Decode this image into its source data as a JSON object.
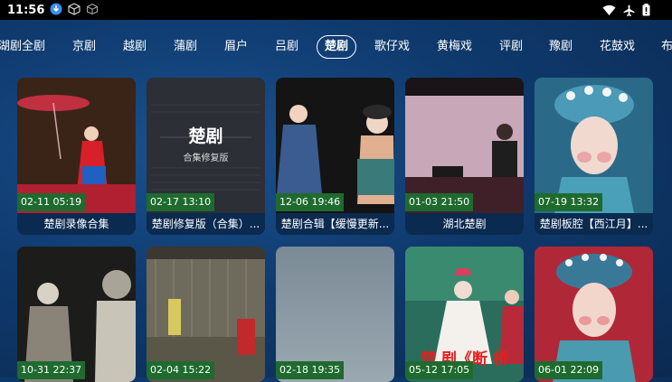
{
  "status": {
    "time": "11:56"
  },
  "tabs": [
    {
      "label": "湖剧全剧"
    },
    {
      "label": "京剧"
    },
    {
      "label": "越剧"
    },
    {
      "label": "蒲剧"
    },
    {
      "label": "眉户"
    },
    {
      "label": "吕剧"
    },
    {
      "label": "楚剧",
      "active": true
    },
    {
      "label": "歌仔戏"
    },
    {
      "label": "黄梅戏"
    },
    {
      "label": "评剧"
    },
    {
      "label": "豫剧"
    },
    {
      "label": "花鼓戏"
    },
    {
      "label": "布"
    }
  ],
  "cards_row1": [
    {
      "date": "02-11 05:19",
      "title": "楚剧录像合集"
    },
    {
      "date": "02-17 13:10",
      "title": "楚剧修复版（合集）...",
      "poster_title": "楚剧",
      "poster_sub": "合集修复版"
    },
    {
      "date": "12-06 19:46",
      "title": "楚剧合辑【缓慢更新..."
    },
    {
      "date": "01-03 21:50",
      "title": "湖北楚剧"
    },
    {
      "date": "07-19 13:32",
      "title": "楚剧板腔【西江月】..."
    }
  ],
  "cards_row2": [
    {
      "date": "10-31 22:37"
    },
    {
      "date": "02-04 15:22"
    },
    {
      "date": "02-18 19:35"
    },
    {
      "date": "05-12 17:05",
      "overlay": "楚 剧《断 桥"
    },
    {
      "date": "06-01 22:09"
    }
  ],
  "colors": {
    "accent_badge": "#1f6b2f",
    "background": "#0f3a6e"
  }
}
